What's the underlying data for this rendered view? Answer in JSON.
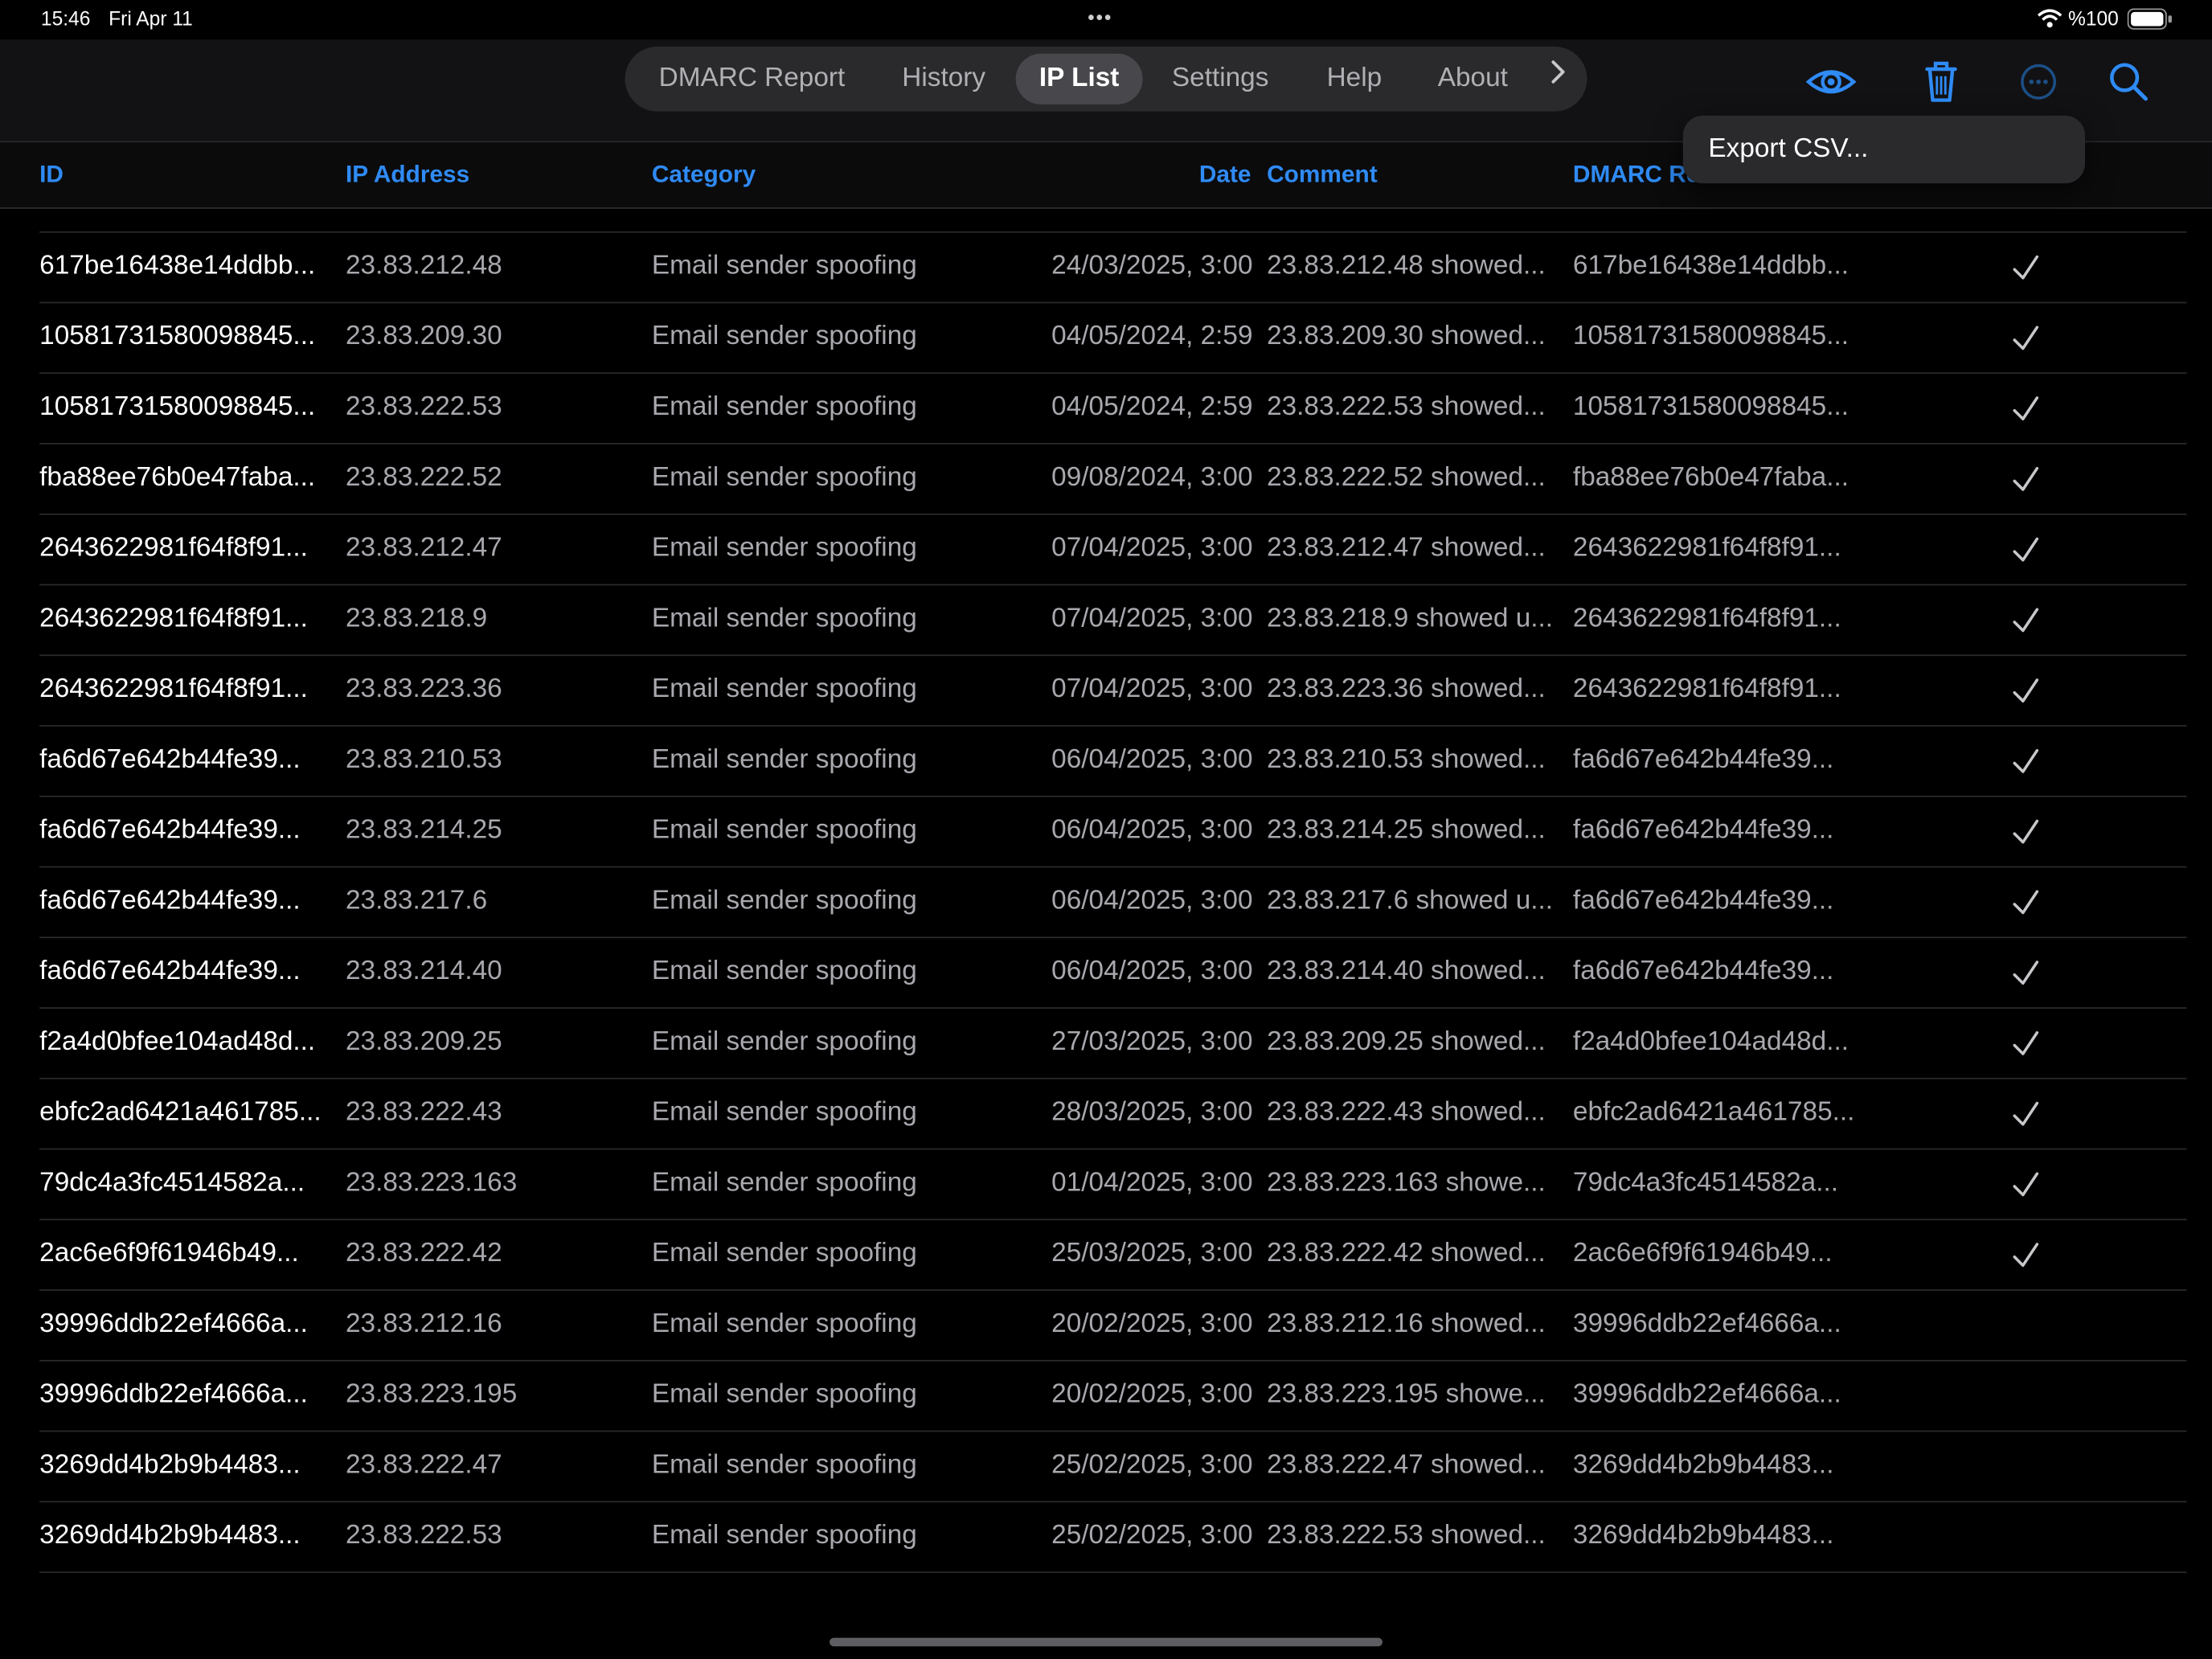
{
  "status": {
    "time": "15:46",
    "date": "Fri Apr 11",
    "battery": "%100"
  },
  "nav": {
    "tabs": [
      {
        "label": "DMARC Report",
        "active": false
      },
      {
        "label": "History",
        "active": false
      },
      {
        "label": "IP List",
        "active": true
      },
      {
        "label": "Settings",
        "active": false
      },
      {
        "label": "Help",
        "active": false
      },
      {
        "label": "About",
        "active": false
      }
    ],
    "more_icon": "chevron-right-icon",
    "tools": [
      "eye-icon",
      "trash-icon",
      "ellipsis-circle-icon",
      "search-icon"
    ],
    "accent": "#2f8bf5"
  },
  "table": {
    "columns": [
      "ID",
      "IP Address",
      "Category",
      "Date",
      "Comment",
      "DMARC Re"
    ],
    "rows": [
      {
        "id": "617be16438e14ddbb...",
        "ip": "23.83.212.48",
        "category": "Email sender spoofing",
        "date": "24/03/2025, 3:00",
        "comment": "23.83.212.48 showed...",
        "report": "617be16438e14ddbb...",
        "checked": true
      },
      {
        "id": "10581731580098845...",
        "ip": "23.83.209.30",
        "category": "Email sender spoofing",
        "date": "04/05/2024, 2:59",
        "comment": "23.83.209.30 showed...",
        "report": "10581731580098845...",
        "checked": true
      },
      {
        "id": "10581731580098845...",
        "ip": "23.83.222.53",
        "category": "Email sender spoofing",
        "date": "04/05/2024, 2:59",
        "comment": "23.83.222.53 showed...",
        "report": "10581731580098845...",
        "checked": true
      },
      {
        "id": "fba88ee76b0e47faba...",
        "ip": "23.83.222.52",
        "category": "Email sender spoofing",
        "date": "09/08/2024, 3:00",
        "comment": "23.83.222.52 showed...",
        "report": "fba88ee76b0e47faba...",
        "checked": true
      },
      {
        "id": "2643622981f64f8f91...",
        "ip": "23.83.212.47",
        "category": "Email sender spoofing",
        "date": "07/04/2025, 3:00",
        "comment": "23.83.212.47 showed...",
        "report": "2643622981f64f8f91...",
        "checked": true
      },
      {
        "id": "2643622981f64f8f91...",
        "ip": "23.83.218.9",
        "category": "Email sender spoofing",
        "date": "07/04/2025, 3:00",
        "comment": "23.83.218.9 showed u...",
        "report": "2643622981f64f8f91...",
        "checked": true
      },
      {
        "id": "2643622981f64f8f91...",
        "ip": "23.83.223.36",
        "category": "Email sender spoofing",
        "date": "07/04/2025, 3:00",
        "comment": "23.83.223.36 showed...",
        "report": "2643622981f64f8f91...",
        "checked": true
      },
      {
        "id": "fa6d67e642b44fe39...",
        "ip": "23.83.210.53",
        "category": "Email sender spoofing",
        "date": "06/04/2025, 3:00",
        "comment": "23.83.210.53 showed...",
        "report": "fa6d67e642b44fe39...",
        "checked": true
      },
      {
        "id": "fa6d67e642b44fe39...",
        "ip": "23.83.214.25",
        "category": "Email sender spoofing",
        "date": "06/04/2025, 3:00",
        "comment": "23.83.214.25 showed...",
        "report": "fa6d67e642b44fe39...",
        "checked": true
      },
      {
        "id": "fa6d67e642b44fe39...",
        "ip": "23.83.217.6",
        "category": "Email sender spoofing",
        "date": "06/04/2025, 3:00",
        "comment": "23.83.217.6 showed u...",
        "report": "fa6d67e642b44fe39...",
        "checked": true
      },
      {
        "id": "fa6d67e642b44fe39...",
        "ip": "23.83.214.40",
        "category": "Email sender spoofing",
        "date": "06/04/2025, 3:00",
        "comment": "23.83.214.40 showed...",
        "report": "fa6d67e642b44fe39...",
        "checked": true
      },
      {
        "id": "f2a4d0bfee104ad48d...",
        "ip": "23.83.209.25",
        "category": "Email sender spoofing",
        "date": "27/03/2025, 3:00",
        "comment": "23.83.209.25 showed...",
        "report": "f2a4d0bfee104ad48d...",
        "checked": true
      },
      {
        "id": "ebfc2ad6421a461785...",
        "ip": "23.83.222.43",
        "category": "Email sender spoofing",
        "date": "28/03/2025, 3:00",
        "comment": "23.83.222.43 showed...",
        "report": "ebfc2ad6421a461785...",
        "checked": true
      },
      {
        "id": "79dc4a3fc4514582a...",
        "ip": "23.83.223.163",
        "category": "Email sender spoofing",
        "date": "01/04/2025, 3:00",
        "comment": "23.83.223.163 showe...",
        "report": "79dc4a3fc4514582a...",
        "checked": true
      },
      {
        "id": "2ac6e6f9f61946b49...",
        "ip": "23.83.222.42",
        "category": "Email sender spoofing",
        "date": "25/03/2025, 3:00",
        "comment": "23.83.222.42 showed...",
        "report": "2ac6e6f9f61946b49...",
        "checked": true
      },
      {
        "id": "39996ddb22ef4666a...",
        "ip": "23.83.212.16",
        "category": "Email sender spoofing",
        "date": "20/02/2025, 3:00",
        "comment": "23.83.212.16 showed...",
        "report": "39996ddb22ef4666a...",
        "checked": false
      },
      {
        "id": "39996ddb22ef4666a...",
        "ip": "23.83.223.195",
        "category": "Email sender spoofing",
        "date": "20/02/2025, 3:00",
        "comment": "23.83.223.195 showe...",
        "report": "39996ddb22ef4666a...",
        "checked": false
      },
      {
        "id": "3269dd4b2b9b4483...",
        "ip": "23.83.222.47",
        "category": "Email sender spoofing",
        "date": "25/02/2025, 3:00",
        "comment": "23.83.222.47 showed...",
        "report": "3269dd4b2b9b4483...",
        "checked": false
      },
      {
        "id": "3269dd4b2b9b4483...",
        "ip": "23.83.222.53",
        "category": "Email sender spoofing",
        "date": "25/02/2025, 3:00",
        "comment": "23.83.222.53 showed...",
        "report": "3269dd4b2b9b4483...",
        "checked": false
      }
    ]
  },
  "menu": {
    "items": [
      "Export CSV..."
    ]
  }
}
